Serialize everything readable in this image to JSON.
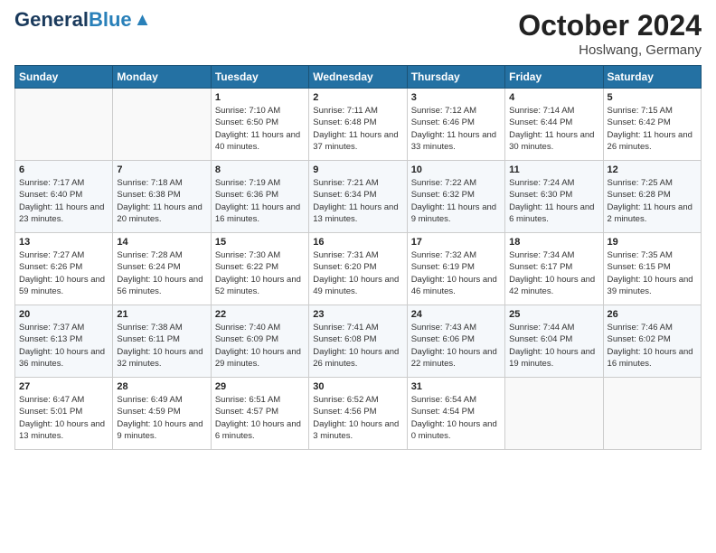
{
  "logo": {
    "general": "General",
    "blue": "Blue"
  },
  "title": {
    "month_year": "October 2024",
    "location": "Hoslwang, Germany"
  },
  "weekdays": [
    "Sunday",
    "Monday",
    "Tuesday",
    "Wednesday",
    "Thursday",
    "Friday",
    "Saturday"
  ],
  "weeks": [
    [
      {
        "day": "",
        "sunrise": "",
        "sunset": "",
        "daylight": ""
      },
      {
        "day": "",
        "sunrise": "",
        "sunset": "",
        "daylight": ""
      },
      {
        "day": "1",
        "sunrise": "Sunrise: 7:10 AM",
        "sunset": "Sunset: 6:50 PM",
        "daylight": "Daylight: 11 hours and 40 minutes."
      },
      {
        "day": "2",
        "sunrise": "Sunrise: 7:11 AM",
        "sunset": "Sunset: 6:48 PM",
        "daylight": "Daylight: 11 hours and 37 minutes."
      },
      {
        "day": "3",
        "sunrise": "Sunrise: 7:12 AM",
        "sunset": "Sunset: 6:46 PM",
        "daylight": "Daylight: 11 hours and 33 minutes."
      },
      {
        "day": "4",
        "sunrise": "Sunrise: 7:14 AM",
        "sunset": "Sunset: 6:44 PM",
        "daylight": "Daylight: 11 hours and 30 minutes."
      },
      {
        "day": "5",
        "sunrise": "Sunrise: 7:15 AM",
        "sunset": "Sunset: 6:42 PM",
        "daylight": "Daylight: 11 hours and 26 minutes."
      }
    ],
    [
      {
        "day": "6",
        "sunrise": "Sunrise: 7:17 AM",
        "sunset": "Sunset: 6:40 PM",
        "daylight": "Daylight: 11 hours and 23 minutes."
      },
      {
        "day": "7",
        "sunrise": "Sunrise: 7:18 AM",
        "sunset": "Sunset: 6:38 PM",
        "daylight": "Daylight: 11 hours and 20 minutes."
      },
      {
        "day": "8",
        "sunrise": "Sunrise: 7:19 AM",
        "sunset": "Sunset: 6:36 PM",
        "daylight": "Daylight: 11 hours and 16 minutes."
      },
      {
        "day": "9",
        "sunrise": "Sunrise: 7:21 AM",
        "sunset": "Sunset: 6:34 PM",
        "daylight": "Daylight: 11 hours and 13 minutes."
      },
      {
        "day": "10",
        "sunrise": "Sunrise: 7:22 AM",
        "sunset": "Sunset: 6:32 PM",
        "daylight": "Daylight: 11 hours and 9 minutes."
      },
      {
        "day": "11",
        "sunrise": "Sunrise: 7:24 AM",
        "sunset": "Sunset: 6:30 PM",
        "daylight": "Daylight: 11 hours and 6 minutes."
      },
      {
        "day": "12",
        "sunrise": "Sunrise: 7:25 AM",
        "sunset": "Sunset: 6:28 PM",
        "daylight": "Daylight: 11 hours and 2 minutes."
      }
    ],
    [
      {
        "day": "13",
        "sunrise": "Sunrise: 7:27 AM",
        "sunset": "Sunset: 6:26 PM",
        "daylight": "Daylight: 10 hours and 59 minutes."
      },
      {
        "day": "14",
        "sunrise": "Sunrise: 7:28 AM",
        "sunset": "Sunset: 6:24 PM",
        "daylight": "Daylight: 10 hours and 56 minutes."
      },
      {
        "day": "15",
        "sunrise": "Sunrise: 7:30 AM",
        "sunset": "Sunset: 6:22 PM",
        "daylight": "Daylight: 10 hours and 52 minutes."
      },
      {
        "day": "16",
        "sunrise": "Sunrise: 7:31 AM",
        "sunset": "Sunset: 6:20 PM",
        "daylight": "Daylight: 10 hours and 49 minutes."
      },
      {
        "day": "17",
        "sunrise": "Sunrise: 7:32 AM",
        "sunset": "Sunset: 6:19 PM",
        "daylight": "Daylight: 10 hours and 46 minutes."
      },
      {
        "day": "18",
        "sunrise": "Sunrise: 7:34 AM",
        "sunset": "Sunset: 6:17 PM",
        "daylight": "Daylight: 10 hours and 42 minutes."
      },
      {
        "day": "19",
        "sunrise": "Sunrise: 7:35 AM",
        "sunset": "Sunset: 6:15 PM",
        "daylight": "Daylight: 10 hours and 39 minutes."
      }
    ],
    [
      {
        "day": "20",
        "sunrise": "Sunrise: 7:37 AM",
        "sunset": "Sunset: 6:13 PM",
        "daylight": "Daylight: 10 hours and 36 minutes."
      },
      {
        "day": "21",
        "sunrise": "Sunrise: 7:38 AM",
        "sunset": "Sunset: 6:11 PM",
        "daylight": "Daylight: 10 hours and 32 minutes."
      },
      {
        "day": "22",
        "sunrise": "Sunrise: 7:40 AM",
        "sunset": "Sunset: 6:09 PM",
        "daylight": "Daylight: 10 hours and 29 minutes."
      },
      {
        "day": "23",
        "sunrise": "Sunrise: 7:41 AM",
        "sunset": "Sunset: 6:08 PM",
        "daylight": "Daylight: 10 hours and 26 minutes."
      },
      {
        "day": "24",
        "sunrise": "Sunrise: 7:43 AM",
        "sunset": "Sunset: 6:06 PM",
        "daylight": "Daylight: 10 hours and 22 minutes."
      },
      {
        "day": "25",
        "sunrise": "Sunrise: 7:44 AM",
        "sunset": "Sunset: 6:04 PM",
        "daylight": "Daylight: 10 hours and 19 minutes."
      },
      {
        "day": "26",
        "sunrise": "Sunrise: 7:46 AM",
        "sunset": "Sunset: 6:02 PM",
        "daylight": "Daylight: 10 hours and 16 minutes."
      }
    ],
    [
      {
        "day": "27",
        "sunrise": "Sunrise: 6:47 AM",
        "sunset": "Sunset: 5:01 PM",
        "daylight": "Daylight: 10 hours and 13 minutes."
      },
      {
        "day": "28",
        "sunrise": "Sunrise: 6:49 AM",
        "sunset": "Sunset: 4:59 PM",
        "daylight": "Daylight: 10 hours and 9 minutes."
      },
      {
        "day": "29",
        "sunrise": "Sunrise: 6:51 AM",
        "sunset": "Sunset: 4:57 PM",
        "daylight": "Daylight: 10 hours and 6 minutes."
      },
      {
        "day": "30",
        "sunrise": "Sunrise: 6:52 AM",
        "sunset": "Sunset: 4:56 PM",
        "daylight": "Daylight: 10 hours and 3 minutes."
      },
      {
        "day": "31",
        "sunrise": "Sunrise: 6:54 AM",
        "sunset": "Sunset: 4:54 PM",
        "daylight": "Daylight: 10 hours and 0 minutes."
      },
      {
        "day": "",
        "sunrise": "",
        "sunset": "",
        "daylight": ""
      },
      {
        "day": "",
        "sunrise": "",
        "sunset": "",
        "daylight": ""
      }
    ]
  ]
}
